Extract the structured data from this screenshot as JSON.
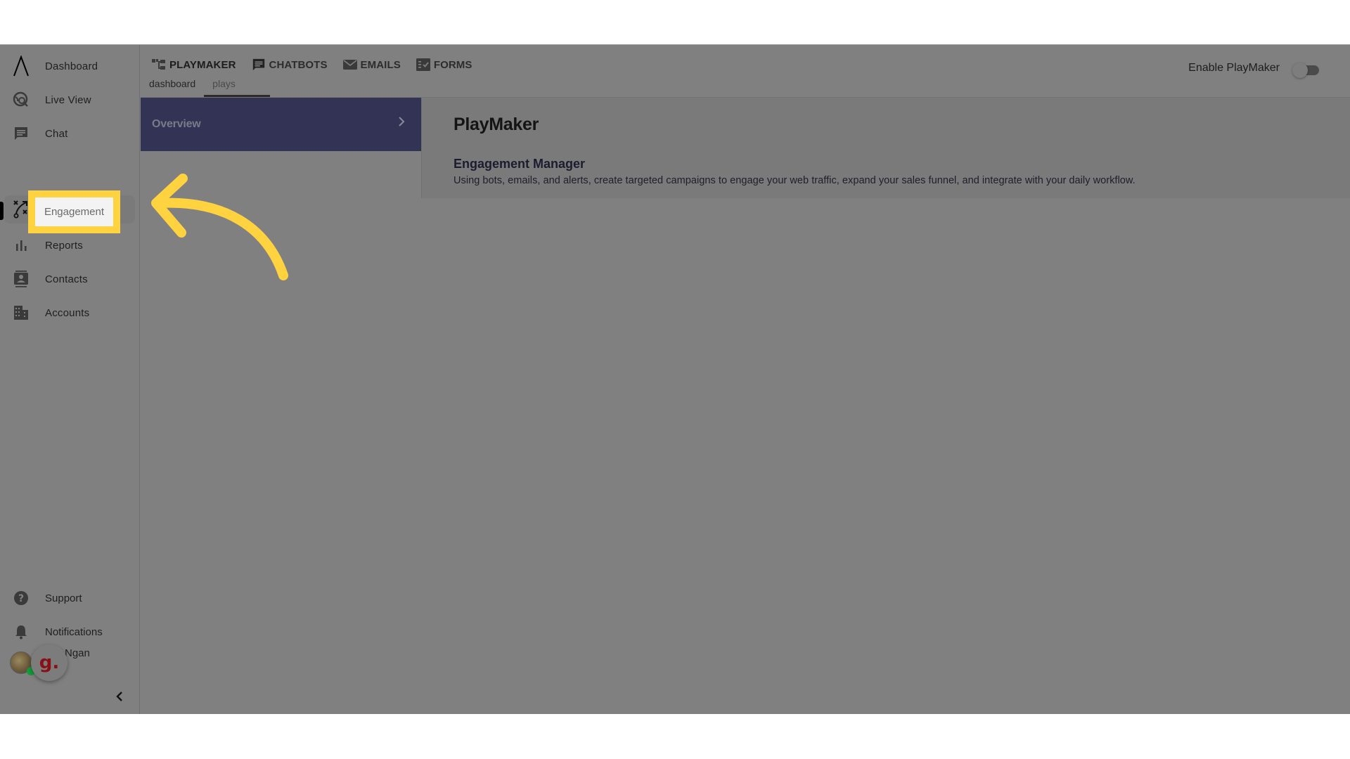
{
  "sidebar": {
    "items": [
      {
        "label": "Dashboard",
        "icon": "logo-caret-icon"
      },
      {
        "label": "Live View",
        "icon": "globe-search-icon"
      },
      {
        "label": "Chat",
        "icon": "chat-bubble-icon"
      },
      {
        "label": "Engagement",
        "icon": "playbook-icon",
        "active": true
      },
      {
        "label": "Reports",
        "icon": "bar-chart-icon"
      },
      {
        "label": "Contacts",
        "icon": "contact-card-icon"
      },
      {
        "label": "Accounts",
        "icon": "building-icon"
      }
    ],
    "bottom": [
      {
        "label": "Support",
        "icon": "help-circle-icon"
      },
      {
        "label": "Notifications",
        "icon": "bell-icon"
      }
    ],
    "user": {
      "name": "Ngan",
      "badge_letter": "g."
    },
    "collapse_icon": "chevron-left-icon"
  },
  "topnav": {
    "tabs": [
      {
        "label": "PLAYMAKER",
        "icon": "tree-icon"
      },
      {
        "label": "CHATBOTS",
        "icon": "chat-bubble-icon"
      },
      {
        "label": "EMAILS",
        "icon": "envelope-icon"
      },
      {
        "label": "FORMS",
        "icon": "form-check-icon"
      }
    ],
    "subtabs": [
      {
        "label": "dashboard"
      },
      {
        "label": "plays",
        "selected": true
      }
    ],
    "enable_label": "Enable PlayMaker",
    "enable_on": false
  },
  "overview": {
    "label": "Overview"
  },
  "card": {
    "title": "PlayMaker",
    "subtitle": "Engagement Manager",
    "description": "Using bots, emails, and alerts, create targeted campaigns to engage your web traffic, expand your sales funnel, and integrate with your daily workflow."
  },
  "annotation": {
    "highlight_label": "Engagement",
    "highlight_color": "#ffd23f",
    "arrow_color": "#ffd23f"
  },
  "colors": {
    "overlay_gray": "#808080",
    "overview_bg": "#333356"
  }
}
